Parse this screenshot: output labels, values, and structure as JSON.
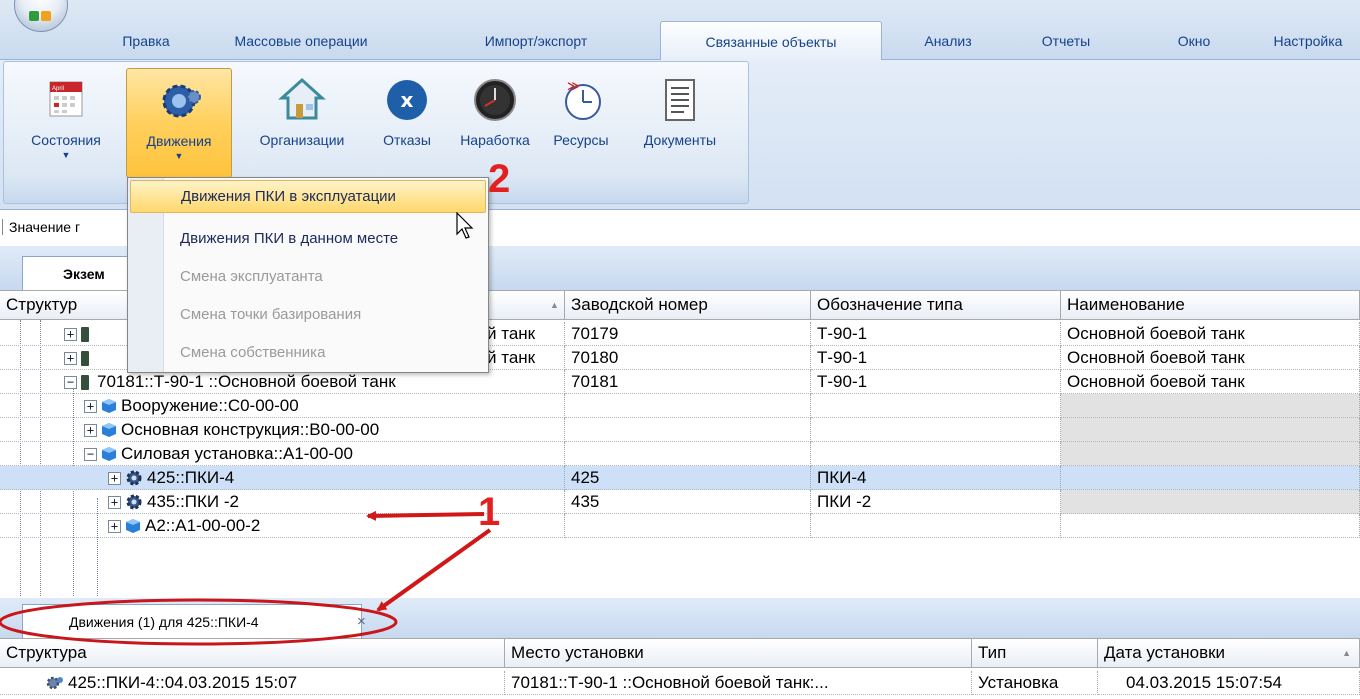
{
  "tabs": [
    {
      "label": "Правка",
      "active": false
    },
    {
      "label": "Массовые операции",
      "active": false
    },
    {
      "label": "Импорт/экспорт",
      "active": false
    },
    {
      "label": "Связанные объекты",
      "active": true
    },
    {
      "label": "Анализ",
      "active": false
    },
    {
      "label": "Отчеты",
      "active": false
    },
    {
      "label": "Окно",
      "active": false
    },
    {
      "label": "Настройка",
      "active": false
    }
  ],
  "ribbon": {
    "buttons": [
      {
        "label": "Состояния",
        "icon": "calendar-icon",
        "dropdown": true
      },
      {
        "label": "Движения",
        "icon": "gears-icon",
        "dropdown": true,
        "pressed": true
      },
      {
        "label": "Организации",
        "icon": "house-icon"
      },
      {
        "label": "Отказы",
        "icon": "x-circle-icon"
      },
      {
        "label": "Наработка",
        "icon": "clock-icon"
      },
      {
        "label": "Ресурсы",
        "icon": "resource-clock-icon"
      },
      {
        "label": "Документы",
        "icon": "document-icon"
      }
    ],
    "calendar_text": "April"
  },
  "dropdown_menu": [
    {
      "label": "Движения ПКИ в эксплуатации",
      "enabled": true,
      "highlighted": true
    },
    {
      "label": "Движения ПКИ в данном месте",
      "enabled": true
    },
    {
      "label": "Смена эксплуатанта",
      "enabled": false
    },
    {
      "label": "Смена точки базирования",
      "enabled": false
    },
    {
      "label": "Смена собственника",
      "enabled": false
    }
  ],
  "filter_bar": {
    "text": "Значение г"
  },
  "doc_tab": {
    "label": "Экзем"
  },
  "main_grid": {
    "columns": [
      "Структур",
      "Заводской номер",
      "Обозначение типа",
      "Наименование"
    ],
    "rows": [
      {
        "tree": "й танк",
        "toggle": "+",
        "icon": "tank-icon",
        "serial": "70179",
        "type": "Т-90-1",
        "name": "Основной боевой танк"
      },
      {
        "tree": "й танк",
        "toggle": "+",
        "icon": "tank-icon",
        "serial": "70180",
        "type": "Т-90-1",
        "name": "Основной боевой танк"
      },
      {
        "tree": "70181::Т-90-1 ::Основной боевой танк",
        "toggle": "−",
        "icon": "tank-icon",
        "serial": "70181",
        "type": "Т-90-1",
        "name": "Основной боевой танк"
      },
      {
        "tree": "Вооружение::С0-00-00",
        "toggle": "+",
        "icon": "cube-icon",
        "serial": "",
        "type": "",
        "name": ""
      },
      {
        "tree": "Основная конструкция::В0-00-00",
        "toggle": "+",
        "icon": "cube-icon",
        "serial": "",
        "type": "",
        "name": ""
      },
      {
        "tree": "Силовая установка::А1-00-00",
        "toggle": "−",
        "icon": "cube-icon",
        "serial": "",
        "type": "",
        "name": ""
      },
      {
        "tree": "425::ПКИ-4",
        "toggle": "+",
        "icon": "gear-icon",
        "serial": "425",
        "type": "ПКИ-4",
        "name": "",
        "selected": true
      },
      {
        "tree": "435::ПКИ -2",
        "toggle": "+",
        "icon": "gear-icon",
        "serial": "435",
        "type": "ПКИ -2",
        "name": ""
      },
      {
        "tree": "А2::А1-00-00-2",
        "toggle": "+",
        "icon": "cube-icon",
        "serial": "",
        "type": "",
        "name": ""
      }
    ]
  },
  "bottom_tab": {
    "label": "Движения (1) для 425::ПКИ-4",
    "close": "×"
  },
  "bottom_grid": {
    "columns": [
      "Структура",
      "Место установки",
      "Тип",
      "Дата установки"
    ],
    "rows": [
      {
        "structure": "425::ПКИ-4::04.03.2015 15:07",
        "icon": "gears-icon",
        "place": "70181::Т-90-1 ::Основной боевой танк:...",
        "type": "Установка",
        "date": "04.03.2015 15:07:54"
      }
    ]
  },
  "annotations": {
    "one": "1",
    "two": "2"
  },
  "colors": {
    "accent": "#15428b",
    "highlight": "#ffd86c",
    "selection": "#cde0f7",
    "annotation": "#e41f1f"
  }
}
